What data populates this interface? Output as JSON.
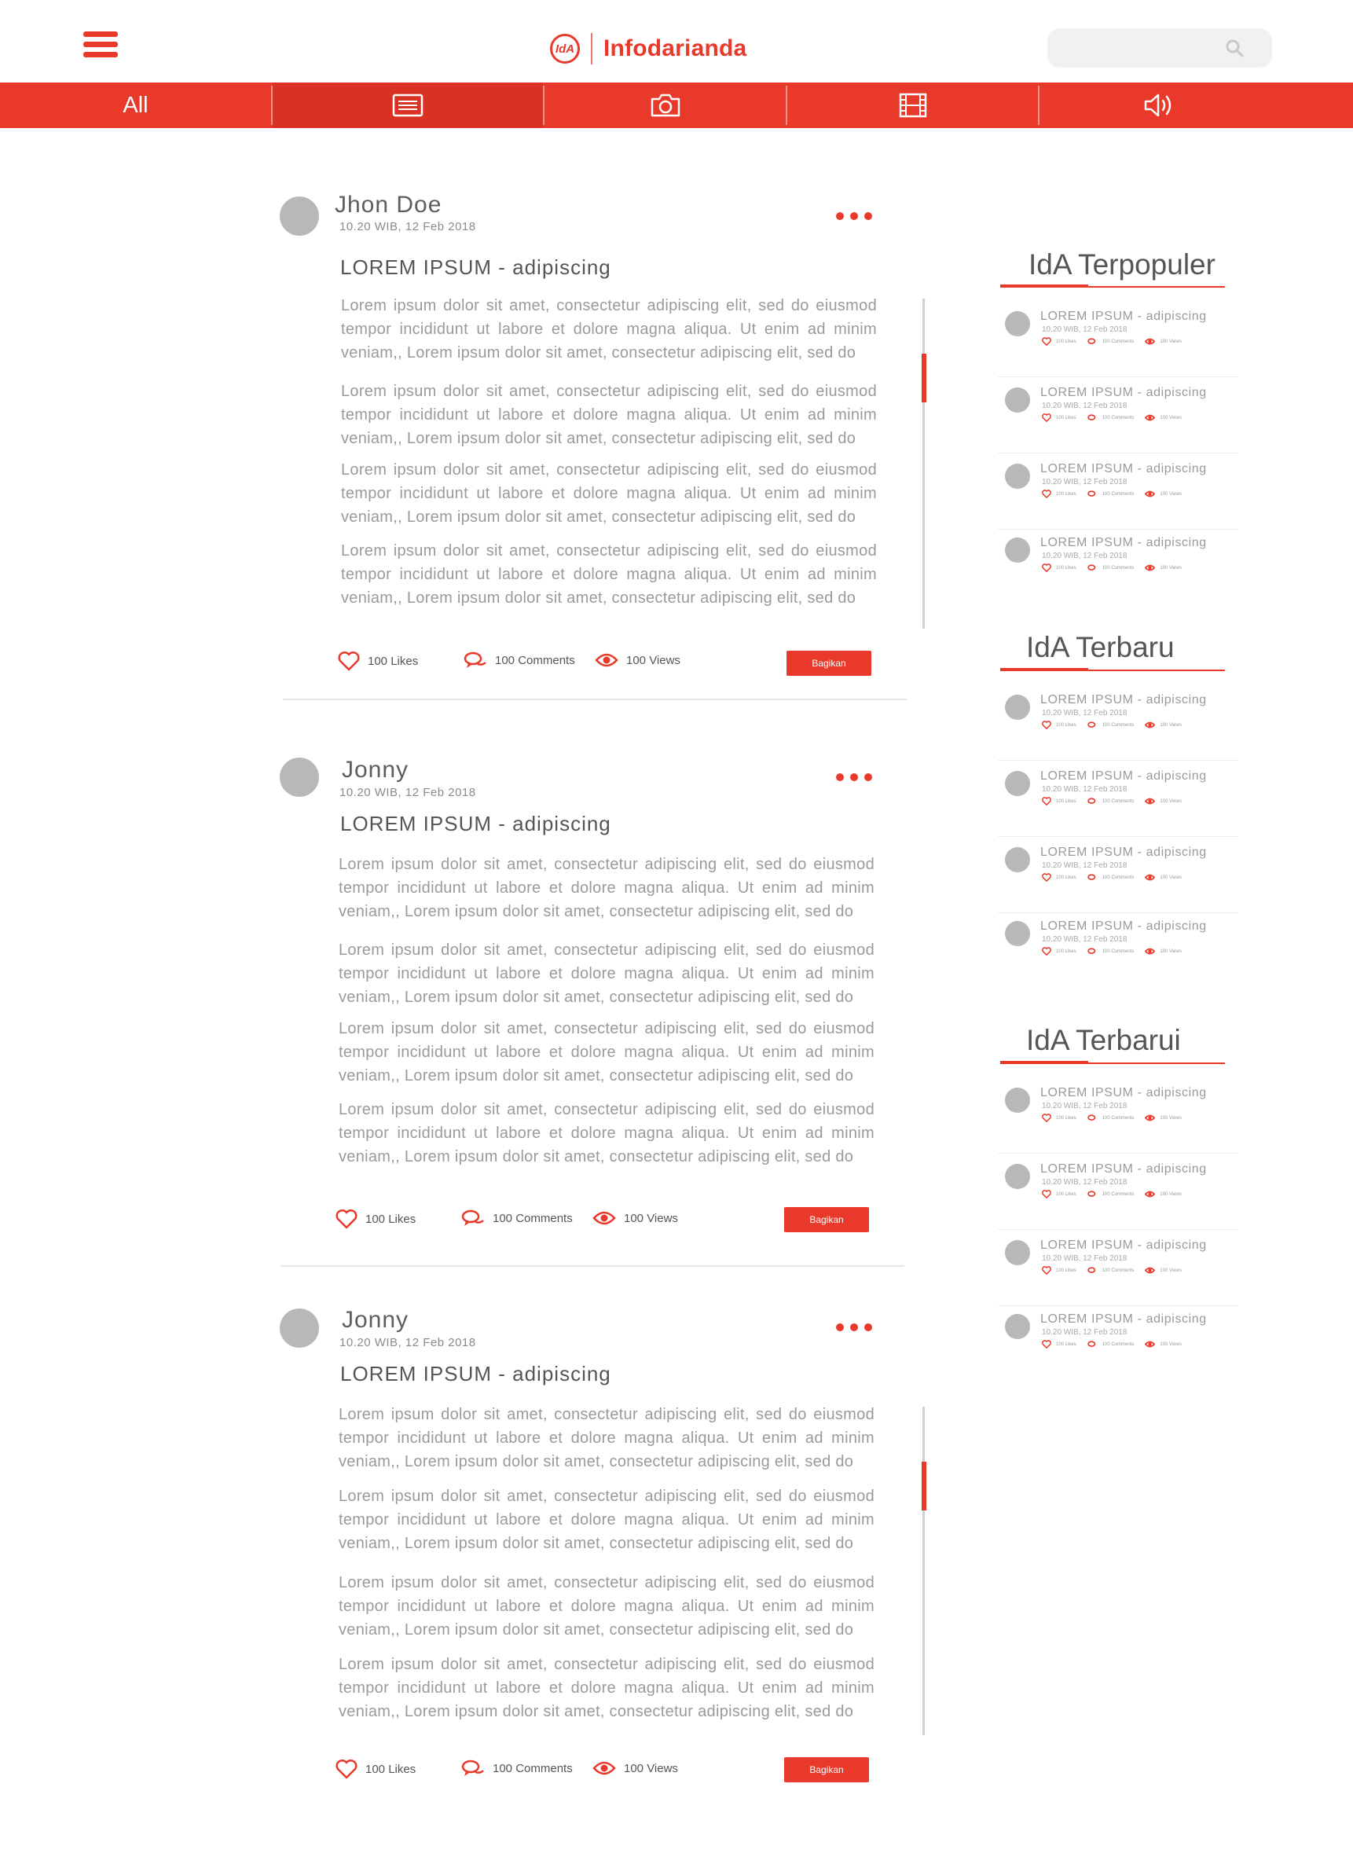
{
  "header": {
    "logo_mark": "IdA",
    "brand": "Infodarianda"
  },
  "nav": {
    "tabs": [
      {
        "label": "All",
        "icon": "list-icon"
      },
      {
        "label": "",
        "icon": "article-icon"
      },
      {
        "label": "",
        "icon": "camera-icon"
      },
      {
        "label": "",
        "icon": "film-icon"
      },
      {
        "label": "",
        "icon": "speaker-icon"
      }
    ],
    "active": 1
  },
  "posts": [
    {
      "author": "Jhon Doe",
      "time": "10.20 WIB, 12 Feb 2018",
      "title": "LOREM IPSUM - adipiscing",
      "paragraphs": [
        "Lorem ipsum dolor sit amet, consectetur adipiscing elit, sed do eiusmod tempor incididunt ut labore et dolore magna aliqua. Ut enim ad minim veniam,, Lorem ipsum dolor sit amet, consectetur adipiscing elit, sed do",
        "Lorem ipsum dolor sit amet, consectetur adipiscing elit, sed do eiusmod tempor incididunt ut labore et dolore magna aliqua. Ut enim ad minim veniam,, Lorem ipsum dolor sit amet, consectetur adipiscing elit, sed do",
        "Lorem ipsum dolor sit amet, consectetur adipiscing elit, sed do eiusmod tempor incididunt ut labore et dolore magna aliqua. Ut enim ad minim veniam,, Lorem ipsum dolor sit amet, consectetur adipiscing elit, sed do",
        "Lorem ipsum dolor sit amet, consectetur adipiscing elit, sed do eiusmod tempor incididunt ut labore et dolore magna aliqua. Ut enim ad minim veniam,, Lorem ipsum dolor sit amet, consectetur adipiscing elit, sed do"
      ],
      "likes": "100  Likes",
      "comments": "100  Comments",
      "views": "100  Views",
      "share": "Bagikan"
    },
    {
      "author": "Jonny",
      "time": "10.20 WIB, 12 Feb 2018",
      "title": "LOREM IPSUM - adipiscing",
      "paragraphs": [
        "Lorem ipsum dolor sit amet, consectetur adipiscing elit, sed do eiusmod tempor incididunt ut labore et dolore magna aliqua. Ut enim ad minim veniam,, Lorem ipsum dolor sit amet, consectetur adipiscing elit, sed do",
        "Lorem ipsum dolor sit amet, consectetur adipiscing elit, sed do eiusmod tempor incididunt ut labore et dolore magna aliqua. Ut enim ad minim veniam,, Lorem ipsum dolor sit amet, consectetur adipiscing elit, sed do",
        "Lorem ipsum dolor sit amet, consectetur adipiscing elit, sed do eiusmod tempor incididunt ut labore et dolore magna aliqua. Ut enim ad minim veniam,, Lorem ipsum dolor sit amet, consectetur adipiscing elit, sed do",
        "Lorem ipsum dolor sit amet, consectetur adipiscing elit, sed do eiusmod tempor incididunt ut labore et dolore magna aliqua. Ut enim ad minim veniam,, Lorem ipsum dolor sit amet, consectetur adipiscing elit, sed do"
      ],
      "likes": "100  Likes",
      "comments": "100  Comments",
      "views": "100  Views",
      "share": "Bagikan"
    },
    {
      "author": "Jonny",
      "time": "10.20 WIB, 12 Feb 2018",
      "title": "LOREM IPSUM - adipiscing",
      "paragraphs": [
        "Lorem ipsum dolor sit amet, consectetur adipiscing elit, sed do eiusmod tempor incididunt ut labore et dolore magna aliqua. Ut enim ad minim veniam,, Lorem ipsum dolor sit amet, consectetur adipiscing elit, sed do",
        "Lorem ipsum dolor sit amet, consectetur adipiscing elit, sed do eiusmod tempor incididunt ut labore et dolore magna aliqua. Ut enim ad minim veniam,, Lorem ipsum dolor sit amet, consectetur adipiscing elit, sed do",
        "Lorem ipsum dolor sit amet, consectetur adipiscing elit, sed do eiusmod tempor incididunt ut labore et dolore magna aliqua. Ut enim ad minim veniam,, Lorem ipsum dolor sit amet, consectetur adipiscing elit, sed do",
        "Lorem ipsum dolor sit amet, consectetur adipiscing elit, sed do eiusmod tempor incididunt ut labore et dolore magna aliqua. Ut enim ad minim veniam,, Lorem ipsum dolor sit amet, consectetur adipiscing elit, sed do"
      ],
      "likes": "100  Likes",
      "comments": "100  Comments",
      "views": "100  Views",
      "share": "Bagikan"
    }
  ],
  "sidebar": {
    "sections": [
      {
        "heading": "IdA Terpopuler",
        "items": [
          {
            "title": "LOREM IPSUM - adipiscing",
            "time": "10.20 WIB, 12 Feb 2018",
            "likes": "100 Likes",
            "comments": "100 Comments",
            "views": "100 Views"
          },
          {
            "title": "LOREM IPSUM - adipiscing",
            "time": "10.20 WIB, 12 Feb 2018",
            "likes": "100 Likes",
            "comments": "100 Comments",
            "views": "100 Views"
          },
          {
            "title": "LOREM IPSUM - adipiscing",
            "time": "10.20 WIB, 12 Feb 2018",
            "likes": "100 Likes",
            "comments": "100 Comments",
            "views": "100 Views"
          },
          {
            "title": "LOREM IPSUM - adipiscing",
            "time": "10.20 WIB, 12 Feb 2018",
            "likes": "100 Likes",
            "comments": "100 Comments",
            "views": "100 Views"
          }
        ]
      },
      {
        "heading": "IdA Terbaru",
        "items": [
          {
            "title": "LOREM IPSUM - adipiscing",
            "time": "10.20 WIB, 12 Feb 2018",
            "likes": "100 Likes",
            "comments": "100 Comments",
            "views": "100 Views"
          },
          {
            "title": "LOREM IPSUM - adipiscing",
            "time": "10.20 WIB, 12 Feb 2018",
            "likes": "100 Likes",
            "comments": "100 Comments",
            "views": "100 Views"
          },
          {
            "title": "LOREM IPSUM - adipiscing",
            "time": "10.20 WIB, 12 Feb 2018",
            "likes": "100 Likes",
            "comments": "100 Comments",
            "views": "100 Views"
          },
          {
            "title": "LOREM IPSUM - adipiscing",
            "time": "10.20 WIB, 12 Feb 2018",
            "likes": "100 Likes",
            "comments": "100 Comments",
            "views": "100 Views"
          }
        ]
      },
      {
        "heading": "IdA Terbarui",
        "items": [
          {
            "title": "LOREM IPSUM - adipiscing",
            "time": "10.20 WIB, 12 Feb 2018",
            "likes": "100 Likes",
            "comments": "100 Comments",
            "views": "100 Views"
          },
          {
            "title": "LOREM IPSUM - adipiscing",
            "time": "10.20 WIB, 12 Feb 2018",
            "likes": "100 Likes",
            "comments": "100 Comments",
            "views": "100 Views"
          },
          {
            "title": "LOREM IPSUM - adipiscing",
            "time": "10.20 WIB, 12 Feb 2018",
            "likes": "100 Likes",
            "comments": "100 Comments",
            "views": "100 Views"
          },
          {
            "title": "LOREM IPSUM - adipiscing",
            "time": "10.20 WIB, 12 Feb 2018",
            "likes": "100 Likes",
            "comments": "100 Comments",
            "views": "100 Views"
          }
        ]
      }
    ]
  },
  "colors": {
    "accent": "#e8392a",
    "avatar": "#b8b8b8",
    "text_muted": "#9a9a9a"
  }
}
